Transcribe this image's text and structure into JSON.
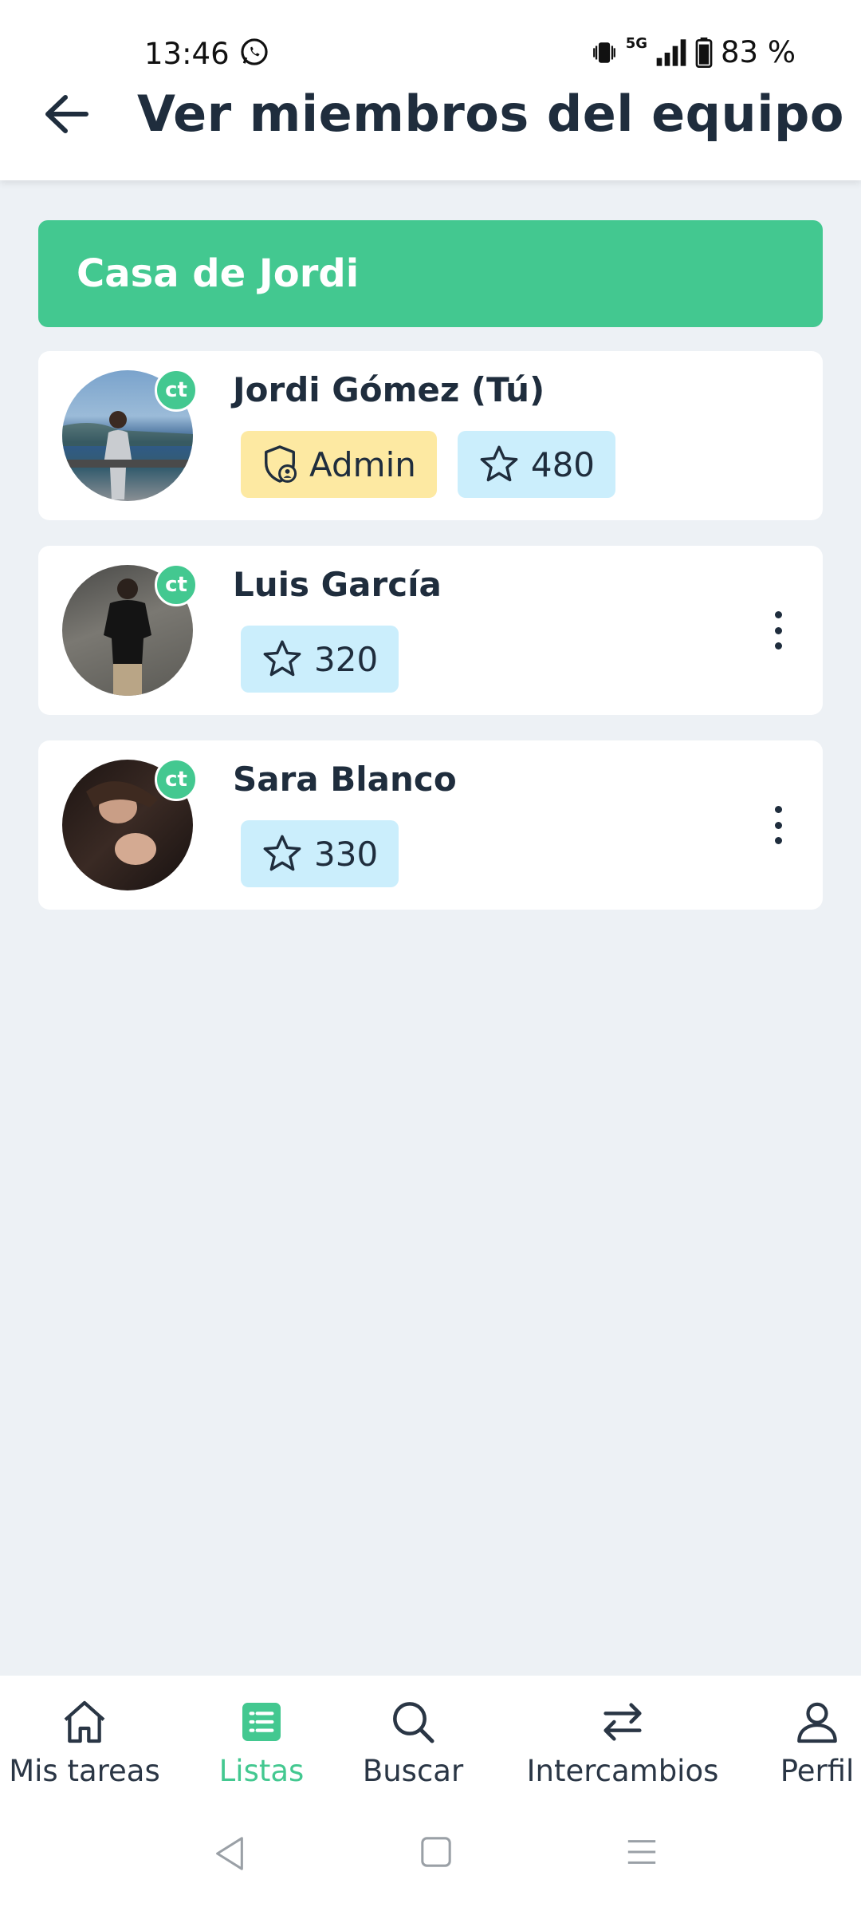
{
  "status_bar": {
    "time": "13:46",
    "battery": "83 %",
    "network": "5G"
  },
  "header": {
    "title": "Ver miembros del equipo"
  },
  "team": {
    "name": "Casa de Jordi"
  },
  "members": [
    {
      "name": "Jordi Gómez (Tú)",
      "role": "Admin",
      "points": "480",
      "badge": "ct"
    },
    {
      "name": "Luis García",
      "points": "320",
      "badge": "ct"
    },
    {
      "name": "Sara Blanco",
      "points": "330",
      "badge": "ct"
    }
  ],
  "bottom_nav": [
    {
      "label": "Mis tareas",
      "icon": "home-icon"
    },
    {
      "label": "Listas",
      "icon": "list-icon",
      "active": true
    },
    {
      "label": "Buscar",
      "icon": "search-icon"
    },
    {
      "label": "Intercambios",
      "icon": "swap-icon"
    },
    {
      "label": "Perfil",
      "icon": "user-icon"
    }
  ],
  "colors": {
    "accent": "#43c890",
    "admin_chip": "#fde9a2",
    "points_chip": "#cbeefc",
    "background": "#edf1f5"
  }
}
